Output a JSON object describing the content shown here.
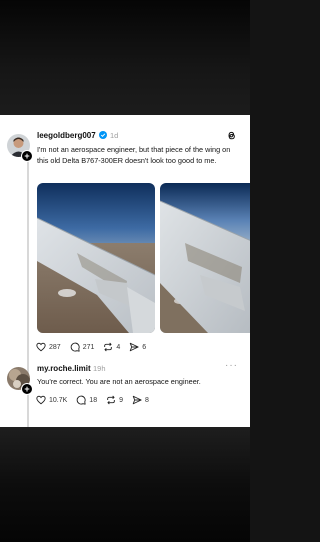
{
  "post": {
    "username": "leegoldberg007",
    "time": "1d",
    "text": "I'm not an aerospace engineer, but that piece of the wing on this old Delta B767-300ER doesn't look too good to me.",
    "likes": "287",
    "replies": "271",
    "reposts": "4",
    "shares": "6"
  },
  "reply": {
    "username": "my.roche.limit",
    "time": "19h",
    "text": "You're correct.  You are not an aerospace engineer.",
    "likes": "10.7K",
    "replies": "18",
    "reposts": "9",
    "shares": "8"
  },
  "icons": {
    "verified": "verified-badge-icon",
    "app": "threads-logo-icon",
    "like": "heart-icon",
    "reply": "comment-icon",
    "repost": "repost-icon",
    "share": "send-icon",
    "more": "more-icon"
  },
  "colors": {
    "verified": "#0095f6",
    "text": "#101010",
    "muted": "#a0a0a0"
  }
}
